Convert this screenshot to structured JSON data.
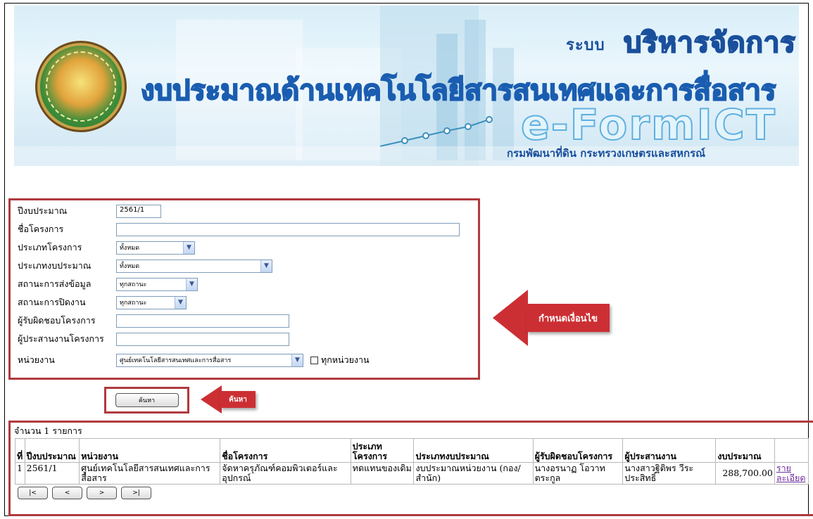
{
  "banner": {
    "system_prefix": "ระบบ",
    "system_title": "บริหารจัดการ",
    "main_title": "งบประมาณด้านเทคโนโลยีสารสนเทศและการสื่อสาร",
    "product_name": "e-FormICT",
    "department": "กรมพัฒนาที่ดิน กระทรวงเกษตรและสหกรณ์"
  },
  "form": {
    "fiscal_year_label": "ปีงบประมาณ",
    "fiscal_year_value": "2561/1",
    "project_name_label": "ชื่อโครงการ",
    "project_name_value": "",
    "project_type_label": "ประเภทโครงการ",
    "project_type_value": "ทั้งหมด",
    "budget_type_label": "ประเภทงบประมาณ",
    "budget_type_value": "ทั้งหมด",
    "submit_status_label": "สถานะการส่งข้อมูล",
    "submit_status_value": "ทุกสถานะ",
    "close_status_label": "สถานะการปิดงาน",
    "close_status_value": "ทุกสถานะ",
    "owner_label": "ผู้รับผิดชอบโครงการ",
    "owner_value": "",
    "coordinator_label": "ผู้ประสานงานโครงการ",
    "coordinator_value": "",
    "unit_label": "หน่วยงาน",
    "unit_value": "ศูนย์เทคโนโลยีสารสนเทศและการสื่อสาร",
    "all_units_label": "ทุกหน่วยงาน",
    "search_button": "ค้นหา"
  },
  "callouts": {
    "conditions": "กำหนดเงื่อนไข",
    "search": "ค้นหา"
  },
  "results": {
    "count_text": "จำนวน 1 รายการ",
    "columns": [
      "ที่",
      "ปีงบประมาณ",
      "หน่วยงาน",
      "ชื่อโครงการ",
      "ประเภทโครงการ",
      "ประเภทงบประมาณ",
      "ผู้รับผิดชอบโครงการ",
      "ผู้ประสานงาน",
      "งบประมาณ",
      ""
    ],
    "rows": [
      {
        "no": "1",
        "year": "2561/1",
        "unit": "ศูนย์เทคโนโลยีสารสนเทศและการสื่อสาร",
        "project": "จัดหาครุภัณฑ์คอมพิวเตอร์และอุปกรณ์",
        "project_type": "ทดแทนของเดิม",
        "budget_type": "งบประมาณหน่วยงาน (กอง/สำนัก)",
        "owner": "นางอรนาฏ โอวาทตระกูล",
        "coordinator": "นางสาวฐิติพร วีระประสิทธิ์",
        "budget": "288,700.00",
        "detail": "รายละเอียด"
      }
    ],
    "pager": [
      "|<",
      "<",
      ">",
      ">|"
    ]
  },
  "colors": {
    "highlight_border": "#b03a3e",
    "callout_fill": "#cc2f33",
    "title_blue": "#1a4f9c"
  }
}
